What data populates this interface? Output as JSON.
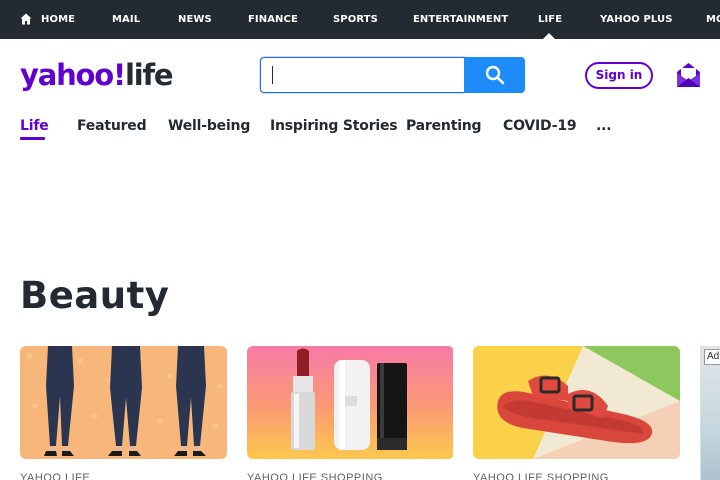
{
  "topnav": {
    "items": [
      "HOME",
      "MAIL",
      "NEWS",
      "FINANCE",
      "SPORTS",
      "ENTERTAINMENT",
      "LIFE",
      "YAHOO PLUS",
      "MO"
    ],
    "active": "LIFE"
  },
  "header": {
    "logo_yahoo": "yahoo!",
    "logo_life": "life",
    "search_value": "",
    "search_icon": "search-icon",
    "signin_label": "Sign in",
    "mail_icon": "mail-icon"
  },
  "subnav": {
    "items": [
      "Life",
      "Featured",
      "Well-being",
      "Inspiring Stories",
      "Parenting",
      "COVID-19",
      "..."
    ],
    "active": "Life"
  },
  "section": {
    "title": "Beauty"
  },
  "cards": [
    {
      "image": "women-in-navy-pants",
      "source": "YAHOO LIFE"
    },
    {
      "image": "lipsticks",
      "source": "YAHOO LIFE SHOPPING"
    },
    {
      "image": "red-sandal",
      "source": "YAHOO LIFE SHOPPING"
    }
  ],
  "ad": {
    "badge": "Ad"
  },
  "colors": {
    "brand_purple": "#6001d2",
    "topnav_bg": "#232a31",
    "search_button": "#1d8cf8"
  }
}
